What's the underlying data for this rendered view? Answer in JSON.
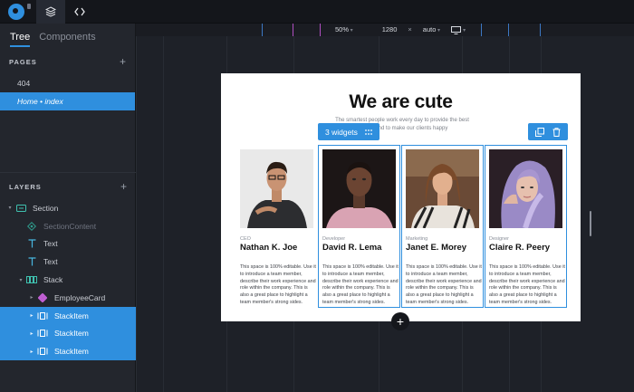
{
  "topbar": {
    "logo_icon": "quarkly-logo-icon",
    "layers_icon": "layers-icon",
    "code_icon": "code-icon"
  },
  "left_panel": {
    "tabs": [
      {
        "label": "Tree",
        "active": true
      },
      {
        "label": "Components",
        "active": false
      }
    ],
    "pages_title": "PAGES",
    "pages": [
      {
        "label": "404",
        "selected": false
      },
      {
        "label": "Home • index",
        "selected": true
      }
    ],
    "layers_title": "LAYERS",
    "layers": [
      {
        "label": "Section",
        "icon": "section-icon",
        "depth": 0,
        "caret": "▾",
        "selected": false,
        "muted": false
      },
      {
        "label": "SectionContent",
        "icon": "component-outline-icon",
        "depth": 1,
        "caret": "",
        "selected": false,
        "muted": true
      },
      {
        "label": "Text",
        "icon": "text-icon",
        "depth": 1,
        "caret": "",
        "selected": false,
        "muted": false
      },
      {
        "label": "Text",
        "icon": "text-icon",
        "depth": 1,
        "caret": "",
        "selected": false,
        "muted": false
      },
      {
        "label": "Stack",
        "icon": "stack-icon",
        "depth": 1,
        "caret": "▾",
        "selected": false,
        "muted": false
      },
      {
        "label": "EmployeeCard",
        "icon": "component-icon",
        "depth": 2,
        "caret": "▸",
        "selected": false,
        "muted": false
      },
      {
        "label": "StackItem",
        "icon": "stackitem-icon",
        "depth": 2,
        "caret": "▸",
        "selected": true,
        "muted": false
      },
      {
        "label": "StackItem",
        "icon": "stackitem-icon",
        "depth": 2,
        "caret": "▸",
        "selected": true,
        "muted": false
      },
      {
        "label": "StackItem",
        "icon": "stackitem-icon",
        "depth": 2,
        "caret": "▸",
        "selected": true,
        "muted": false
      }
    ]
  },
  "toolbar": {
    "zoom": "50%",
    "width": "1280",
    "times": "×",
    "height": "auto",
    "device_icon": "desktop-icon"
  },
  "preview": {
    "heading": "We are cute",
    "subtext_line1": "The smartest people work every day to provide the best",
    "subtext_line2": "service and to make our clients happy",
    "widgets_badge": "3 widgets",
    "add_label": "+",
    "cards": [
      {
        "role": "CEO",
        "name": "Nathan K. Joe",
        "desc": "This space is 100% editable. Use it to introduce a team member, describe their work experience and role within the company. This is also a great place to highlight a team member's strong sides.",
        "selected": false
      },
      {
        "role": "Developer",
        "name": "David R. Lema",
        "desc": "This space is 100% editable. Use it to introduce a team member, describe their work experience and role within the company. This is also a great place to highlight a team member's strong sides.",
        "selected": true
      },
      {
        "role": "Marketing",
        "name": "Janet E. Morey",
        "desc": "This space is 100% editable. Use it to introduce a team member, describe their work experience and role within the company. This is also a great place to highlight a team member's strong sides.",
        "selected": true
      },
      {
        "role": "Designer",
        "name": "Claire R. Peery",
        "desc": "This space is 100% editable. Use it to introduce a team member, describe their work experience and role within the company. This is also a great place to highlight a team member's strong sides.",
        "selected": true
      }
    ]
  },
  "colors": {
    "accent": "#2f8fde",
    "panel": "#23262d",
    "canvas": "#1e2128"
  }
}
